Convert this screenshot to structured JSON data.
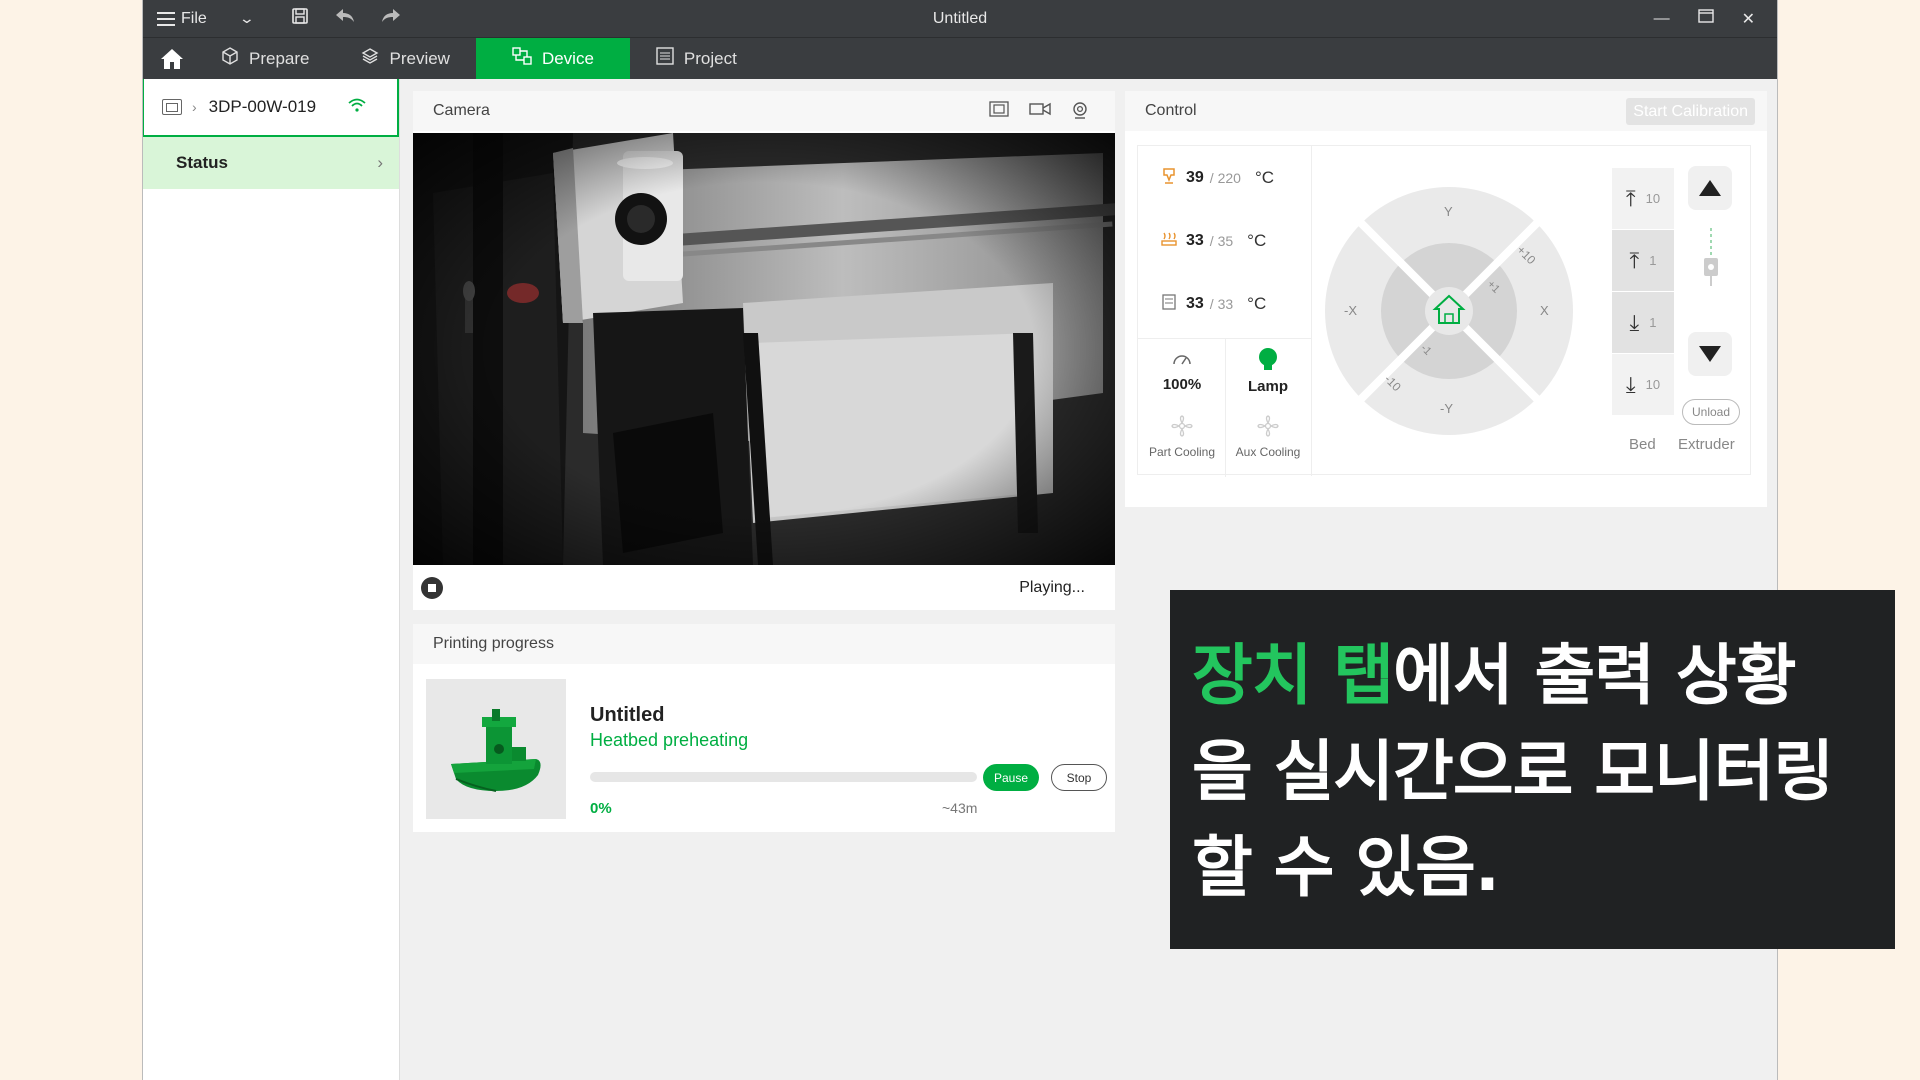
{
  "titlebar": {
    "file_label": "File",
    "title": "Untitled"
  },
  "tabs": [
    {
      "label": "Prepare"
    },
    {
      "label": "Preview"
    },
    {
      "label": "Device"
    },
    {
      "label": "Project"
    }
  ],
  "sidebar": {
    "device_name": "3DP-00W-019",
    "status_label": "Status"
  },
  "camera": {
    "title": "Camera",
    "state": "Playing..."
  },
  "progress": {
    "title": "Printing progress",
    "job_name": "Untitled",
    "stage": "Heatbed preheating",
    "percent_label": "0%",
    "percent": 0,
    "eta": "~43m",
    "pause_label": "Pause",
    "stop_label": "Stop"
  },
  "control": {
    "title": "Control",
    "calibration_label": "Start Calibration",
    "temps": [
      {
        "current": "39",
        "target": "/ 220",
        "unit": "°C"
      },
      {
        "current": "33",
        "target": "/ 35",
        "unit": "°C"
      },
      {
        "current": "33",
        "target": "/ 33",
        "unit": "°C"
      }
    ],
    "speed": "100%",
    "lamp": "Lamp",
    "part_cooling": "Part Cooling",
    "aux_cooling": "Aux Cooling",
    "axes": {
      "y": "Y",
      "neg_y": "-Y",
      "x": "X",
      "neg_x": "-X",
      "p10": "+10",
      "p1": "+1",
      "m1": "-1",
      "m10": "-10"
    },
    "z_steps": [
      "10",
      "1",
      "1",
      "10"
    ],
    "bed_label": "Bed",
    "extruder_label": "Extruder",
    "unload_label": "Unload"
  },
  "caption": {
    "highlight": "장치 탭",
    "line1": "에서 출력 상황",
    "line2": "을 실시간으로 모니터링",
    "line3": "할 수 있음."
  },
  "colors": {
    "accent": "#00ae42",
    "dark_bar": "#3a3d40",
    "caption_bg": "#202223"
  }
}
